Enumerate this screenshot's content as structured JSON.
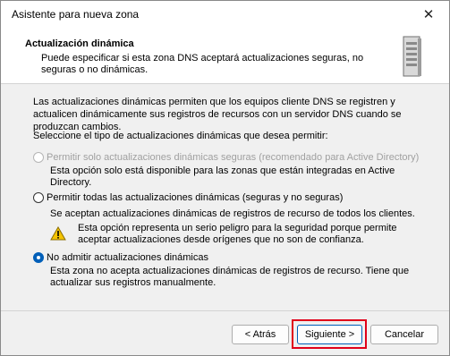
{
  "window": {
    "title": "Asistente para nueva zona",
    "close_glyph": "✕"
  },
  "header": {
    "title": "Actualización dinámica",
    "description": "Puede especificar si esta zona DNS aceptará actualizaciones seguras, no seguras o no dinámicas.",
    "icon": "server-icon"
  },
  "body": {
    "intro": "Las actualizaciones dinámicas permiten que los equipos cliente DNS se registren y actualicen dinámicamente sus registros de recursos con un servidor DNS cuando se produzcan cambios.",
    "prompt": "Seleccione el tipo de actualizaciones dinámicas que desea permitir:",
    "options": [
      {
        "label": "Permitir solo actualizaciones dinámicas seguras (recomendado para Active Directory)",
        "description": "Esta opción solo está disponible para las zonas que están integradas en Active Directory.",
        "state": "disabled"
      },
      {
        "label": "Permitir todas las actualizaciones dinámicas (seguras y no seguras)",
        "description": "Se aceptan actualizaciones dinámicas de registros de recurso de todos los clientes.",
        "warning": "Esta opción representa un serio peligro para la seguridad porque permite aceptar actualizaciones desde orígenes que no son de confianza.",
        "state": "unselected"
      },
      {
        "label": "No admitir actualizaciones dinámicas",
        "description": "Esta zona no acepta actualizaciones dinámicas de registros de recurso. Tiene que actualizar sus registros manualmente.",
        "state": "selected"
      }
    ]
  },
  "footer": {
    "back_label": "< Atrás",
    "next_label": "Siguiente >",
    "cancel_label": "Cancelar"
  },
  "colors": {
    "accent": "#005fb8",
    "highlight": "#e0001a",
    "warning": "#f5c400"
  }
}
